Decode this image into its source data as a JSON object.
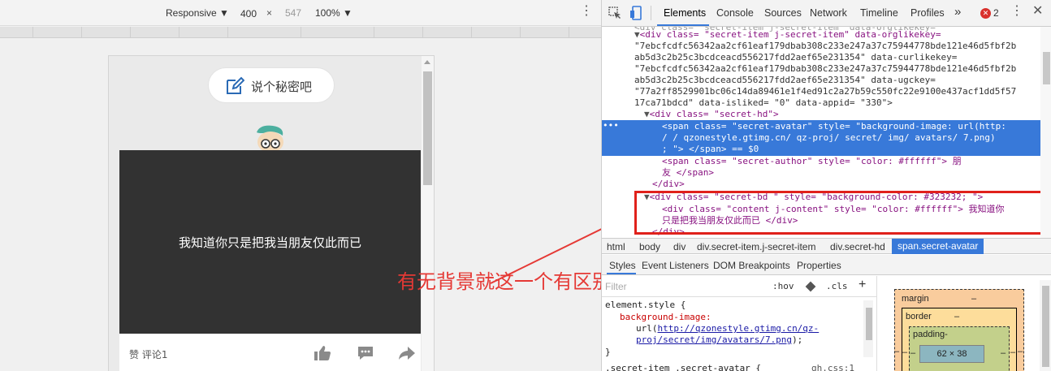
{
  "device_toolbar": {
    "mode": "Responsive",
    "width": "400",
    "times": "×",
    "height": "547",
    "zoom": "100%"
  },
  "page": {
    "say_secret": "说个秘密吧",
    "author": "朋友",
    "content": "我知道你只是把我当朋友仅此而已",
    "footer_like": "赞",
    "footer_comment": "评论1",
    "card_bg": "#323232"
  },
  "annotation": "有无背景就这一个有区别",
  "devtools": {
    "tabs": [
      "Elements",
      "Console",
      "Sources",
      "Network",
      "Timeline",
      "Profiles"
    ],
    "overflow": "»",
    "error_count": "2",
    "lines": [
      [
        "0",
        "",
        "",
        "",
        "div class=\"secret-item j-secret-item\""
      ],
      [
        "1",
        "▼",
        "<div ",
        "class",
        "= \"secret-item j-secret-item\" data-orglikekey="
      ],
      [
        "2",
        "",
        "",
        "",
        "\"7ebcfcdfc56342aa2cf61eaf179dbab308c233e247a37c75944778bde121e46d5fbf2b"
      ],
      [
        "3",
        "",
        "",
        "",
        "ab5d3c2b25c3bcdceacd556217fdd2aef65e231354\" data-curlikekey="
      ],
      [
        "4",
        "",
        "",
        "",
        "\"7ebcfcdfc56342aa2cf61eaf179dbab308c233e247a37c75944778bde121e46d5fbf2b"
      ],
      [
        "5",
        "",
        "",
        "",
        "ab5d3c2b25c3bcdceacd556217fdd2aef65e231354\" data-ugckey="
      ],
      [
        "6",
        "",
        "",
        "",
        "\"77a2ff8529901bc06c14da89461e1f4ed91c2a27b59c550fc22e9100e437acf1dd5f57"
      ],
      [
        "7",
        "",
        "",
        "",
        "17ca71bdcd\" data-isliked= \"0\" data-appid= \"330\">"
      ]
    ],
    "code": {
      "l0": "<div class= \"secret-item j-secret-item\" data-orglikekey=",
      "secret_hd": "<div class= \"secret-hd\">",
      "sel1": "<span class= \"secret-avatar\" style= \"background-image:  url(http:",
      "sel2": "/ / qzonestyle.gtimg.cn/ qz-proj/ secret/ img/ avatars/ 7.png)",
      "sel3": "; \"> </span>  == $0",
      "author1": "<span class= \"secret-author\" style= \"color: #ffffff\"> 朋",
      "author2": "友 </span>",
      "close_div": "</div>",
      "bd1": "<div class= \"secret-bd \" style= \"background-color:   #323232; \">",
      "bd2": "<div class= \"content j-content\" style= \"color:  #ffffff\"> 我知道你",
      "bd3": "只是把我当朋友仅此而已 </div>",
      "bd4": "</div>",
      "attr_lines": [
        "\"7ebcfcdfc56342aa2cf61eaf179dbab308c233e247a37c75944778bde121e46d5fbf2b",
        "ab5d3c2b25c3bcdceacd556217fdd2aef65e231354\" data-curlikekey=",
        "\"7ebcfcdfc56342aa2cf61eaf179dbab308c233e247a37c75944778bde121e46d5fbf2b",
        "ab5d3c2b25c3bcdceacd556217fdd2aef65e231354\" data-ugckey=",
        "\"77a2ff8529901bc06c14da89461e1f4ed91c2a27b59c550fc22e9100e437acf1dd5f57",
        "17ca71bdcd\" data-isliked= \"0\" data-appid= \"330\">"
      ]
    },
    "breadcrumbs": [
      "html",
      "body",
      "div",
      "div.secret-item.j-secret-item",
      "div.secret-hd",
      "span.secret-avatar"
    ],
    "subtabs": [
      "Styles",
      "Event Listeners",
      "DOM Breakpoints",
      "Properties"
    ],
    "filter": {
      "placeholder": "Filter",
      "hov": ":hov",
      "cls": ".cls",
      "plus": "+"
    },
    "styles": {
      "selector": "element.style {",
      "prop": "background-image:",
      "url_prefix": "url(",
      "url1": "http://qzonestyle.gtimg.cn/qz-",
      "url2": "proj/secret/img/avatars/7.png",
      "url_suffix": ");",
      "close": "}",
      "next_rule": ".secret-item .secret-avatar {",
      "next_source": "gh.css:1"
    },
    "box_model": {
      "margin": "margin",
      "border": "border",
      "padding": "padding-",
      "content": "62 × 38",
      "dash": "–"
    }
  }
}
